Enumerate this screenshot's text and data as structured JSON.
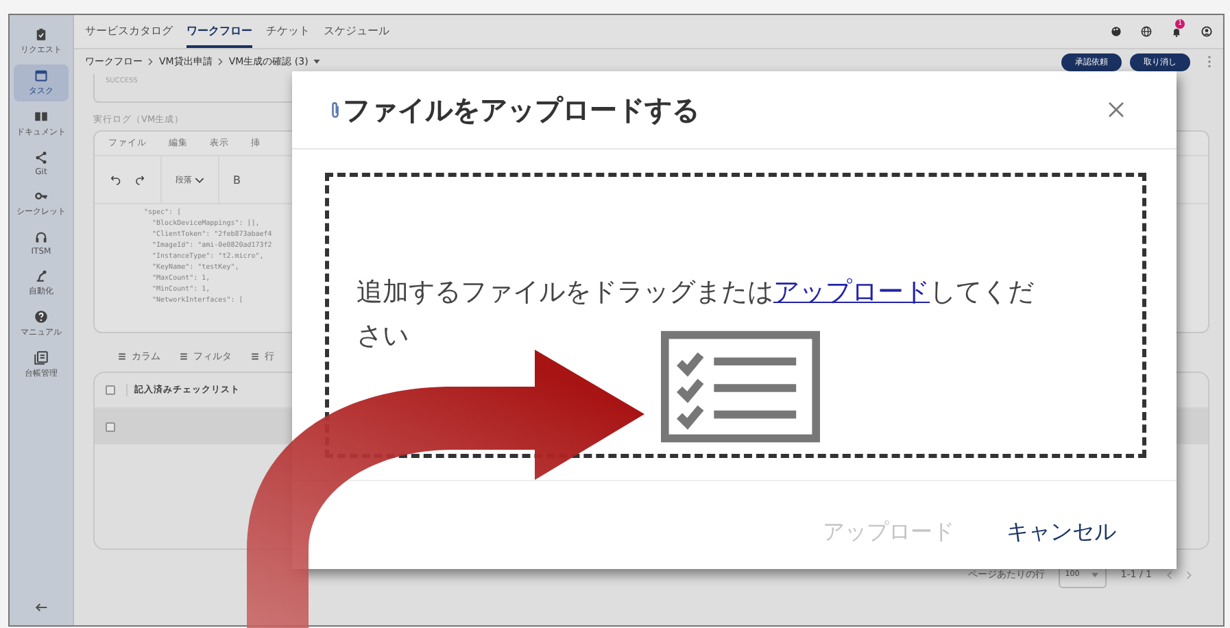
{
  "sidebar": {
    "items": [
      {
        "label": "リクエスト",
        "selected": false
      },
      {
        "label": "タスク",
        "selected": true
      },
      {
        "label": "ドキュメント",
        "selected": false
      },
      {
        "label": "Git",
        "selected": false
      },
      {
        "label": "シークレット",
        "selected": false
      },
      {
        "label": "ITSM",
        "selected": false
      },
      {
        "label": "自動化",
        "selected": false
      },
      {
        "label": "マニュアル",
        "selected": false
      },
      {
        "label": "台帳管理",
        "selected": false
      }
    ]
  },
  "top_tabs": [
    {
      "label": "サービスカタログ",
      "selected": false
    },
    {
      "label": "ワークフロー",
      "selected": true
    },
    {
      "label": "チケット",
      "selected": false
    },
    {
      "label": "スケジュール",
      "selected": false
    }
  ],
  "notification_badge": "1",
  "breadcrumb": [
    "ワークフロー",
    "VM貸出申請",
    "VM生成の確認 (3)"
  ],
  "header_buttons": [
    "承認依頼",
    "取り消し"
  ],
  "status_field": {
    "value": "SUCCESS"
  },
  "log_label": "実行ログ（VM生成）",
  "editor": {
    "menu": [
      "ファイル",
      "編集",
      "表示",
      "挿"
    ],
    "format_select": "段落",
    "bold_button": "B",
    "code_lines": [
      "\"spec\": [",
      "  \"BlockDeviceMappings\": [],",
      "  \"ClientToken\": \"2feb873abaef4",
      "  \"ImageId\": \"ami-0e0820ad173f2",
      "  \"InstanceType\": \"t2.micro\",",
      "  \"KeyName\": \"testKey\",",
      "  \"MaxCount\": 1,",
      "  \"MinCount\": 1,",
      "  \"NetworkInterfaces\": ["
    ]
  },
  "table": {
    "toolbar": [
      "カラム",
      "フィルタ",
      "行"
    ],
    "columns": [
      "記入済みチェックリスト"
    ],
    "rows": [
      {
        "checked": false
      }
    ],
    "header_checked": false
  },
  "pagination": {
    "rows_per_page_label": "ページあたりの行",
    "rows_per_page": "100",
    "range": "1-1 / 1"
  },
  "dialog": {
    "title": "ファイルをアップロードする",
    "drop_text_before": "追加するファイルをドラッグまたは",
    "drop_link": "アップロード",
    "drop_text_after": "してください",
    "buttons": [
      {
        "label": "アップロード",
        "disabled": true
      },
      {
        "label": "キャンセル",
        "disabled": false
      }
    ]
  }
}
